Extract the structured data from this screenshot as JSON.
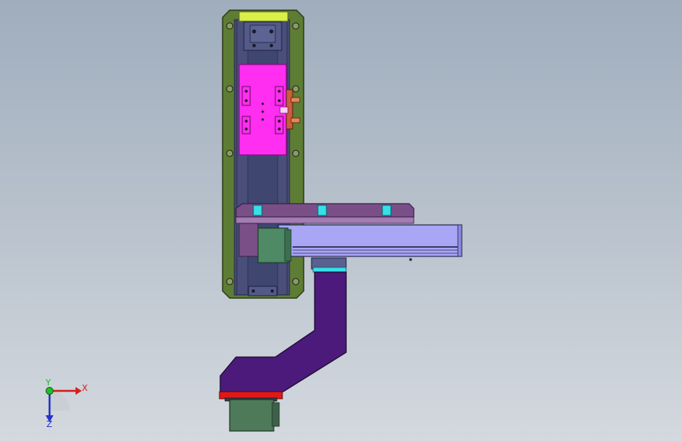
{
  "viewport": {
    "background_top": "#9fadbd",
    "background_bottom": "#d4d9df"
  },
  "model": {
    "colors": {
      "side_plate": "#5e7d34",
      "side_plate_edge": "#2f3d18",
      "rail": "#4a4f7a",
      "rail_edge": "#23264a",
      "end_cap_top": "#d8f04a",
      "carriage": "#ff2ef0",
      "carriage_edge": "#8a0c84",
      "bracket": "#c8603c",
      "cross_plate": "#7a4f88",
      "cross_plate_edge": "#3a2045",
      "slot_block": "#36e0e8",
      "cross_axis": "#a9a6f6",
      "cross_axis_edge": "#2a2a55",
      "motor": "#4e8a66",
      "motor_edge": "#1f3d2a",
      "arm": "#4c1a7a",
      "arm_edge": "#1e0a33",
      "flange_red": "#e01818",
      "gripper": "#4e7a5a",
      "gripper_edge": "#1e3325"
    }
  },
  "triad": {
    "x_label": "X",
    "y_label": "Y",
    "z_label": "Z",
    "x_color": "#d42020",
    "y_color": "#1fbf2a",
    "z_color": "#2233cc"
  }
}
